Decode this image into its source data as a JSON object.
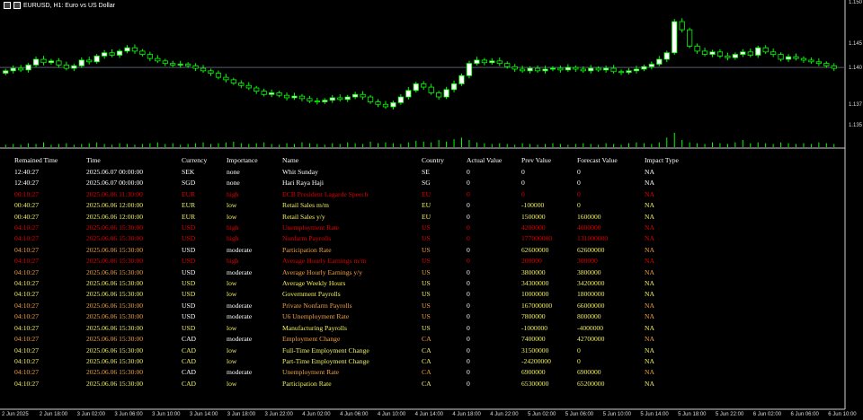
{
  "window": {
    "title": "EURUSD, H1: Euro vs US Dollar"
  },
  "chart_data": {
    "type": "candlestick",
    "symbol": "EURUSD",
    "timeframe": "H1",
    "ylim": [
      1.134,
      1.15
    ],
    "price_labels": [
      "1.150",
      "1.145",
      "1.140",
      "1.137",
      "1.135"
    ],
    "price_label_values": [
      1.15,
      1.145,
      1.142,
      1.1375,
      1.135
    ],
    "current_price_line": 1.1422,
    "time_labels": [
      "2 Jun 2025",
      "2 Jun 18:00",
      "3 Jun 02:00",
      "3 Jun 06:00",
      "3 Jun 10:00",
      "3 Jun 14:00",
      "3 Jun 18:00",
      "3 Jun 22:00",
      "4 Jun 02:00",
      "4 Jun 06:00",
      "4 Jun 10:00",
      "4 Jun 14:00",
      "4 Jun 18:00",
      "4 Jun 22:00",
      "5 Jun 02:00",
      "5 Jun 06:00",
      "5 Jun 10:00",
      "5 Jun 14:00",
      "5 Jun 18:00",
      "5 Jun 22:00",
      "6 Jun 02:00",
      "6 Jun 06:00",
      "6 Jun 10:00"
    ],
    "closes": [
      1.1418,
      1.1421,
      1.1419,
      1.1425,
      1.1432,
      1.1428,
      1.143,
      1.1425,
      1.1421,
      1.1424,
      1.1431,
      1.1429,
      1.1436,
      1.144,
      1.1437,
      1.1442,
      1.1446,
      1.1442,
      1.1438,
      1.1433,
      1.143,
      1.1427,
      1.1425,
      1.1426,
      1.1424,
      1.1421,
      1.1418,
      1.1415,
      1.141,
      1.1407,
      1.1403,
      1.14,
      1.1397,
      1.1393,
      1.1389,
      1.1391,
      1.1388,
      1.1385,
      1.1387,
      1.1384,
      1.1381,
      1.138,
      1.1382,
      1.1385,
      1.1383,
      1.1386,
      1.1389,
      1.1386,
      1.138,
      1.1377,
      1.1374,
      1.1379,
      1.1386,
      1.1394,
      1.1402,
      1.1398,
      1.1391,
      1.1386,
      1.1395,
      1.1402,
      1.1412,
      1.1427,
      1.1431,
      1.1428,
      1.143,
      1.1427,
      1.1423,
      1.142,
      1.1418,
      1.1421,
      1.1418,
      1.142,
      1.1421,
      1.1419,
      1.1422,
      1.142,
      1.1418,
      1.1421,
      1.1419,
      1.1421,
      1.1417,
      1.1416,
      1.1418,
      1.142,
      1.1423,
      1.1426,
      1.1432,
      1.144,
      1.1478,
      1.1468,
      1.1448,
      1.1442,
      1.1438,
      1.1441,
      1.1436,
      1.1434,
      1.1438,
      1.1441,
      1.1437,
      1.1446,
      1.1441,
      1.1438,
      1.1432,
      1.1435,
      1.1433,
      1.1431,
      1.1429,
      1.1427,
      1.1424,
      1.1421
    ],
    "volumes": [
      3,
      4,
      3,
      5,
      4,
      6,
      3,
      4,
      5,
      3,
      4,
      5,
      6,
      4,
      3,
      5,
      4,
      3,
      4,
      5,
      6,
      4,
      5,
      3,
      4,
      5,
      6,
      4,
      5,
      6,
      7,
      5,
      4,
      5,
      6,
      4,
      3,
      5,
      4,
      6,
      5,
      4,
      3,
      5,
      4,
      6,
      5,
      4,
      7,
      5,
      6,
      5,
      4,
      6,
      8,
      7,
      6,
      9,
      7,
      10,
      12,
      9,
      6,
      5,
      4,
      5,
      4,
      3,
      5,
      4,
      3,
      4,
      5,
      4,
      3,
      4,
      5,
      4,
      3,
      5,
      4,
      3,
      5,
      6,
      5,
      4,
      6,
      12,
      18,
      9,
      6,
      5,
      4,
      6,
      5,
      4,
      6,
      9,
      5,
      6,
      5,
      4,
      6,
      5,
      4,
      5,
      4,
      6,
      5,
      4
    ]
  },
  "table": {
    "headers": [
      "Remained Time",
      "Time",
      "Currency",
      "Importance",
      "Name",
      "Country",
      "Actual Value",
      "Prev Value",
      "Forecast Value",
      "Impact Type"
    ],
    "rows": [
      {
        "cells": [
          "12:40:27",
          "2025.06.07 00:00:00",
          "SEK",
          "none",
          "Whit Sunday",
          "SE",
          "0",
          "0",
          "0",
          "NA"
        ],
        "color": "white"
      },
      {
        "cells": [
          "12:40:27",
          "2025.06.07 00:00:00",
          "SGD",
          "none",
          "Hari Raya Haji",
          "SG",
          "0",
          "0",
          "0",
          "NA"
        ],
        "color": "white"
      },
      {
        "cells": [
          "00:10:27",
          "2025.06.06 11:30:00",
          "EUR",
          "high",
          "ECB President Lagarde Speech",
          "EU",
          "0",
          "0",
          "0",
          "NA"
        ],
        "color": "red"
      },
      {
        "cells": [
          "00:40:27",
          "2025.06.06 12:00:00",
          "EUR",
          "low",
          "Retail Sales m/m",
          "EU",
          "0",
          "-100000",
          "0",
          "NA"
        ],
        "color": "yellow"
      },
      {
        "cells": [
          "00:40:27",
          "2025.06.06 12:00:00",
          "EUR",
          "low",
          "Retail Sales y/y",
          "EU",
          "0",
          "1500000",
          "1600000",
          "NA"
        ],
        "color": "yellow"
      },
      {
        "cells": [
          "04:10:27",
          "2025.06.06 15:30:00",
          "USD",
          "high",
          "Unemployment Rate",
          "US",
          "0",
          "4200000",
          "4000000",
          "NA"
        ],
        "color": "red"
      },
      {
        "cells": [
          "04:10:27",
          "2025.06.06 15:30:00",
          "USD",
          "high",
          "Nonfarm Payrolls",
          "US",
          "0",
          "177000000",
          "131000000",
          "NA"
        ],
        "color": "red"
      },
      {
        "cells": [
          "04:10:27",
          "2025.06.06 15:30:00",
          "USD",
          "moderate",
          "Participation Rate",
          "US",
          "0",
          "62600000",
          "62600000",
          "NA"
        ],
        "color": "orange"
      },
      {
        "cells": [
          "04:10:27",
          "2025.06.06 15:30:00",
          "USD",
          "high",
          "Average Hourly Earnings m/m",
          "US",
          "0",
          "200000",
          "300000",
          "NA"
        ],
        "color": "red"
      },
      {
        "cells": [
          "04:10:27",
          "2025.06.06 15:30:00",
          "USD",
          "moderate",
          "Average Hourly Earnings y/y",
          "US",
          "0",
          "3800000",
          "3800000",
          "NA"
        ],
        "color": "orange"
      },
      {
        "cells": [
          "04:10:27",
          "2025.06.06 15:30:00",
          "USD",
          "low",
          "Average Weekly Hours",
          "US",
          "0",
          "34300000",
          "34200000",
          "NA"
        ],
        "color": "yellow"
      },
      {
        "cells": [
          "04:10:27",
          "2025.06.06 15:30:00",
          "USD",
          "low",
          "Government Payrolls",
          "US",
          "0",
          "10000000",
          "18000000",
          "NA"
        ],
        "color": "yellow"
      },
      {
        "cells": [
          "04:10:27",
          "2025.06.06 15:30:00",
          "USD",
          "moderate",
          "Private Nonfarm Payrolls",
          "US",
          "0",
          "167000000",
          "66000000",
          "NA"
        ],
        "color": "orange"
      },
      {
        "cells": [
          "04:10:27",
          "2025.06.06 15:30:00",
          "USD",
          "moderate",
          "U6 Unemployment Rate",
          "US",
          "0",
          "7800000",
          "8000000",
          "NA"
        ],
        "color": "orange"
      },
      {
        "cells": [
          "04:10:27",
          "2025.06.06 15:30:00",
          "USD",
          "low",
          "Manufacturing Payrolls",
          "US",
          "0",
          "-1000000",
          "-4000000",
          "NA"
        ],
        "color": "yellow"
      },
      {
        "cells": [
          "04:10:27",
          "2025.06.06 15:30:00",
          "CAD",
          "moderate",
          "Employment Change",
          "CA",
          "0",
          "7400000",
          "42700000",
          "NA"
        ],
        "color": "orange"
      },
      {
        "cells": [
          "04:10:27",
          "2025.06.06 15:30:00",
          "CAD",
          "low",
          "Full-Time Employment Change",
          "CA",
          "0",
          "31500000",
          "0",
          "NA"
        ],
        "color": "yellow"
      },
      {
        "cells": [
          "04:10:27",
          "2025.06.06 15:30:00",
          "CAD",
          "low",
          "Part-Time Employment Change",
          "CA",
          "0",
          "-24200000",
          "0",
          "NA"
        ],
        "color": "yellow"
      },
      {
        "cells": [
          "04:10:27",
          "2025.06.06 15:30:00",
          "CAD",
          "moderate",
          "Unemployment Rate",
          "CA",
          "0",
          "6900000",
          "6900000",
          "NA"
        ],
        "color": "orange"
      },
      {
        "cells": [
          "04:10:27",
          "2025.06.06 15:30:00",
          "CAD",
          "low",
          "Participation Rate",
          "CA",
          "0",
          "65300000",
          "65200000",
          "NA"
        ],
        "color": "yellow"
      }
    ]
  },
  "colors": {
    "background": "#000000",
    "bull_candle": "#ffffff",
    "bear_candle": "#000000",
    "candle_outline": "#00ff00",
    "volume": "#00ff00",
    "price_line": "#5a5a6e",
    "high": "#e00000",
    "moderate": "#f0a040",
    "low": "#f0f060",
    "none": "#ffffff"
  }
}
